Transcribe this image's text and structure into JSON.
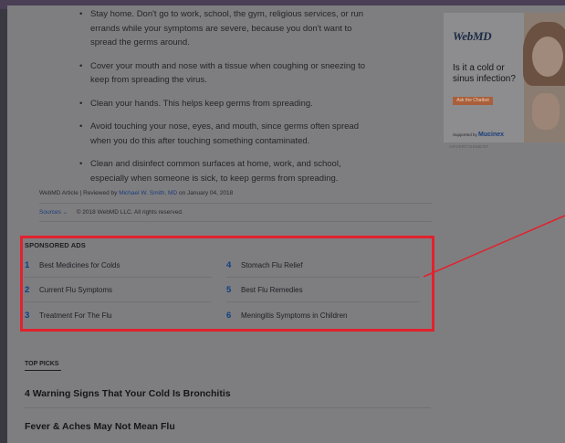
{
  "article": {
    "bullets": [
      "Stay home. Don't go to work, school, the gym, religious services, or run errands while your symptoms are severe, because you don't want to spread the germs around.",
      "Cover your mouth and nose with a tissue when coughing or sneezing to keep from spreading the virus.",
      "Clean your hands. This helps keep germs from spreading.",
      "Avoid touching your nose, eyes, and mouth, since germs often spread when you do this after touching something contaminated.",
      "Clean and disinfect common surfaces at home, work, and school, especially when someone is sick, to keep germs from spreading."
    ],
    "byline_prefix": "WebMD Article | Reviewed by",
    "reviewer": "Michael W. Smith, MD",
    "byline_date": "on January 04, 2018",
    "sources_label": "Sources",
    "sources_chevron": "⌄",
    "copyright": "© 2018 WebMD LLC. All rights reserved."
  },
  "sponsored_ads": {
    "title": "SPONSORED ADS",
    "items": [
      {
        "num": "1",
        "label": "Best Medicines for Colds"
      },
      {
        "num": "2",
        "label": "Current Flu Symptoms"
      },
      {
        "num": "3",
        "label": "Treatment For The Flu"
      },
      {
        "num": "4",
        "label": "Stomach Flu Relief"
      },
      {
        "num": "5",
        "label": "Best Flu Remedies"
      },
      {
        "num": "6",
        "label": "Meningitis Symptoms in Children"
      }
    ]
  },
  "top_picks": {
    "title": "TOP PICKS",
    "items": [
      "4 Warning Signs That Your Cold Is Bronchitis",
      "Fever & Aches May Not Mean Flu"
    ]
  },
  "sidebar_ad": {
    "logo": "WebMD",
    "question": "Is it a cold or sinus infection?",
    "button": "Ask the Chatbot",
    "sponsor_prefix": "Supported by",
    "sponsor_brand": "Mucinex",
    "label": "ADVERTISEMENT"
  },
  "colors": {
    "highlight": "#e1222d",
    "ad_number": "#0f3f84",
    "overlay_dim": "#7e7e80"
  }
}
